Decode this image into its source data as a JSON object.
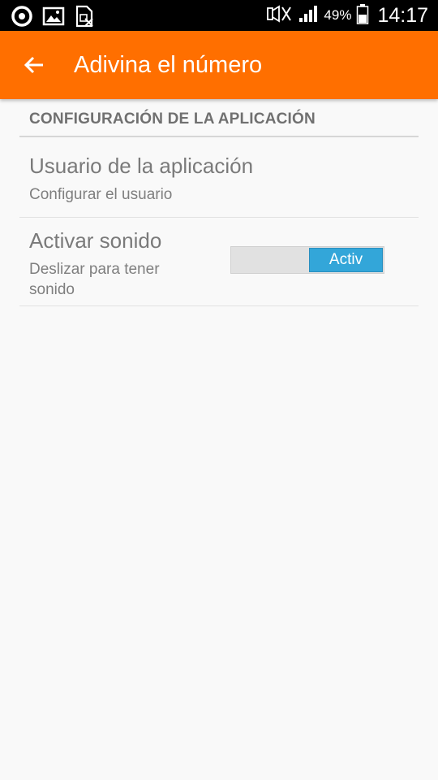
{
  "status_bar": {
    "left_icons": [
      "opera-icon",
      "image-icon",
      "no-sim-icon"
    ],
    "right_icons": [
      "mute-icon",
      "signal-icon",
      "battery-icon"
    ],
    "battery_percent": "49%",
    "time": "14:17"
  },
  "app_bar": {
    "title": "Adivina el número",
    "background_color": "#ff6f00"
  },
  "settings": {
    "category_title": "CONFIGURACIÓN DE LA APLICACIÓN",
    "items": [
      {
        "title": "Usuario de la aplicación",
        "summary": "Configurar el usuario"
      },
      {
        "title": "Activar sonido",
        "summary": "Deslizar para tener sonido",
        "switch_label": "Activ",
        "switch_on": true,
        "switch_color": "#33a6d9"
      }
    ]
  }
}
